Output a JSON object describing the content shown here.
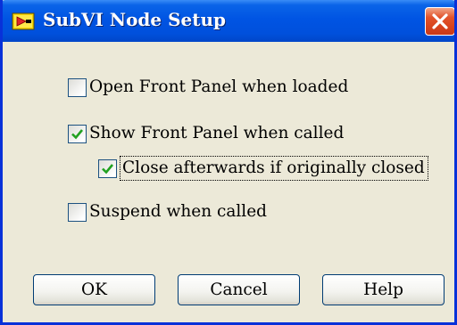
{
  "window": {
    "title": "SubVI Node Setup",
    "icon": "labview-vi-icon",
    "close_icon": "close-x-icon"
  },
  "options": [
    {
      "label": "Open Front Panel when loaded",
      "checked": false
    },
    {
      "label": "Show Front Panel when called",
      "checked": true
    },
    {
      "label": "Close afterwards if originally closed",
      "checked": true,
      "focused": true
    },
    {
      "label": "Suspend when called",
      "checked": false
    }
  ],
  "buttons": {
    "ok": "OK",
    "cancel": "Cancel",
    "help": "Help"
  },
  "colors": {
    "titlebar": "#0054e3",
    "dialog_bg": "#ece9d8",
    "close_button": "#e2532b",
    "checkmark": "#21a121"
  }
}
